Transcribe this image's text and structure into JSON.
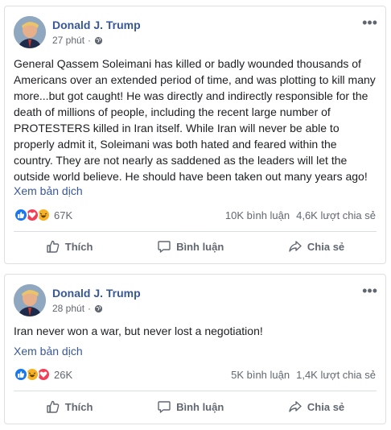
{
  "posts": [
    {
      "author": "Donald J. Trump",
      "time": "27 phút",
      "text": "General Qassem Soleimani has killed or badly wounded thousands of Americans over an extended period of time, and was plotting to kill many more...but got caught! He was directly and indirectly responsible for the death of millions of people, including the recent large number of PROTESTERS killed in Iran itself. While Iran will never be able to properly admit it, Soleimani was both hated and feared within the country. They are not nearly as saddened as the leaders will let the outside world believe. He should have been taken out many years ago!",
      "translate": "Xem bản dịch",
      "reactions_count": "67K",
      "reaction_icons": [
        "like",
        "love",
        "haha"
      ],
      "comments": "10K bình luận",
      "shares": "4,6K lượt chia sẻ",
      "actions": {
        "like": "Thích",
        "comment": "Bình luận",
        "share": "Chia sẻ"
      }
    },
    {
      "author": "Donald J. Trump",
      "time": "28 phút",
      "text": "Iran never won a war, but never lost a negotiation!",
      "translate": "Xem bản dịch",
      "reactions_count": "26K",
      "reaction_icons": [
        "like",
        "haha",
        "love"
      ],
      "comments": "5K bình luận",
      "shares": "1,4K lượt chia sẻ",
      "actions": {
        "like": "Thích",
        "comment": "Bình luận",
        "share": "Chia sẻ"
      }
    }
  ],
  "colors": {
    "like": "#1877f2",
    "love": "#f33e58",
    "haha": "#f7b125",
    "link": "#385898"
  }
}
